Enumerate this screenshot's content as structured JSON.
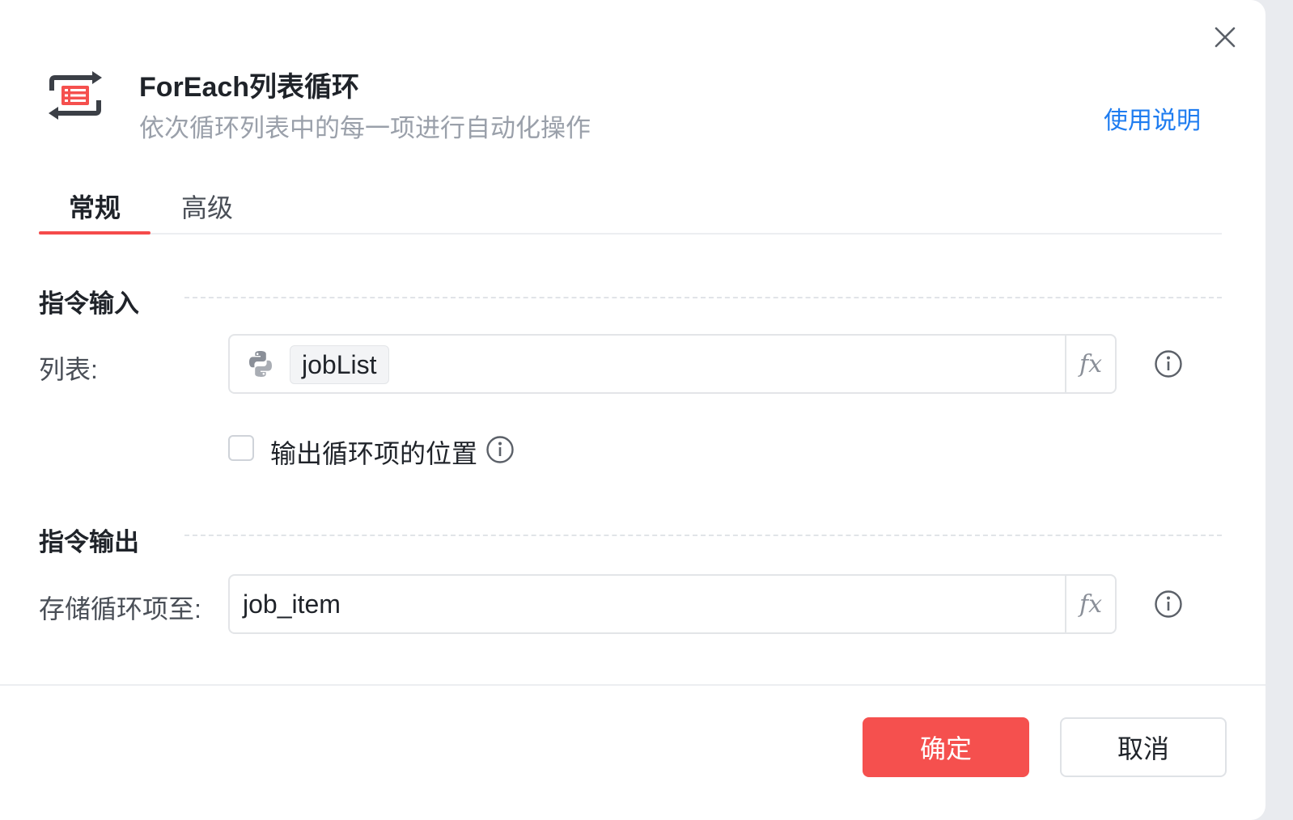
{
  "header": {
    "icon": "foreach-loop-icon",
    "title": "ForEach列表循环",
    "subtitle": "依次循环列表中的每一项进行自动化操作",
    "help_link": "使用说明"
  },
  "tabs": [
    {
      "label": "常规",
      "active": true
    },
    {
      "label": "高级",
      "active": false
    }
  ],
  "input_section": {
    "title": "指令输入",
    "list_field": {
      "label": "列表:",
      "value": "jobList",
      "value_type_icon": "python-icon",
      "fx_label": "fx"
    },
    "output_index_checkbox": {
      "label": "输出循环项的位置",
      "checked": false
    }
  },
  "output_section": {
    "title": "指令输出",
    "store_field": {
      "label": "存储循环项至:",
      "value": "job_item",
      "fx_label": "fx"
    }
  },
  "footer": {
    "ok_label": "确定",
    "cancel_label": "取消"
  },
  "colors": {
    "accent": "#f5504e",
    "link": "#1e7cf0",
    "tab_indicator": "#f54b4b"
  }
}
